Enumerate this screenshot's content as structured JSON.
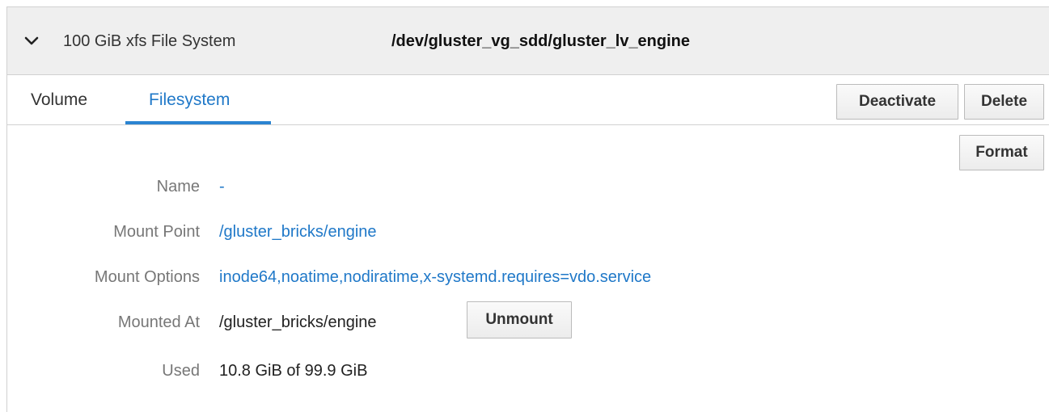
{
  "header": {
    "description": "100 GiB xfs File System",
    "device": "/dev/gluster_vg_sdd/gluster_lv_engine",
    "expanded_icon": "chevron-down-icon"
  },
  "tabs": [
    {
      "label": "Volume",
      "active": false
    },
    {
      "label": "Filesystem",
      "active": true
    }
  ],
  "actions": {
    "deactivate_label": "Deactivate",
    "delete_label": "Delete",
    "format_label": "Format"
  },
  "details": {
    "name": {
      "label": "Name",
      "value": "-"
    },
    "mount_point": {
      "label": "Mount Point",
      "value": "/gluster_bricks/engine"
    },
    "mount_options": {
      "label": "Mount Options",
      "value": "inode64,noatime,nodiratime,x-systemd.requires=vdo.service"
    },
    "mounted_at": {
      "label": "Mounted At",
      "value": "/gluster_bricks/engine",
      "unmount_label": "Unmount"
    },
    "used": {
      "label": "Used",
      "value": "10.8 GiB of 99.9 GiB"
    }
  },
  "colors": {
    "link": "#1f78c8",
    "active_tab_underline": "#2b84d1",
    "header_background": "#efefef",
    "label_gray": "#777777"
  }
}
